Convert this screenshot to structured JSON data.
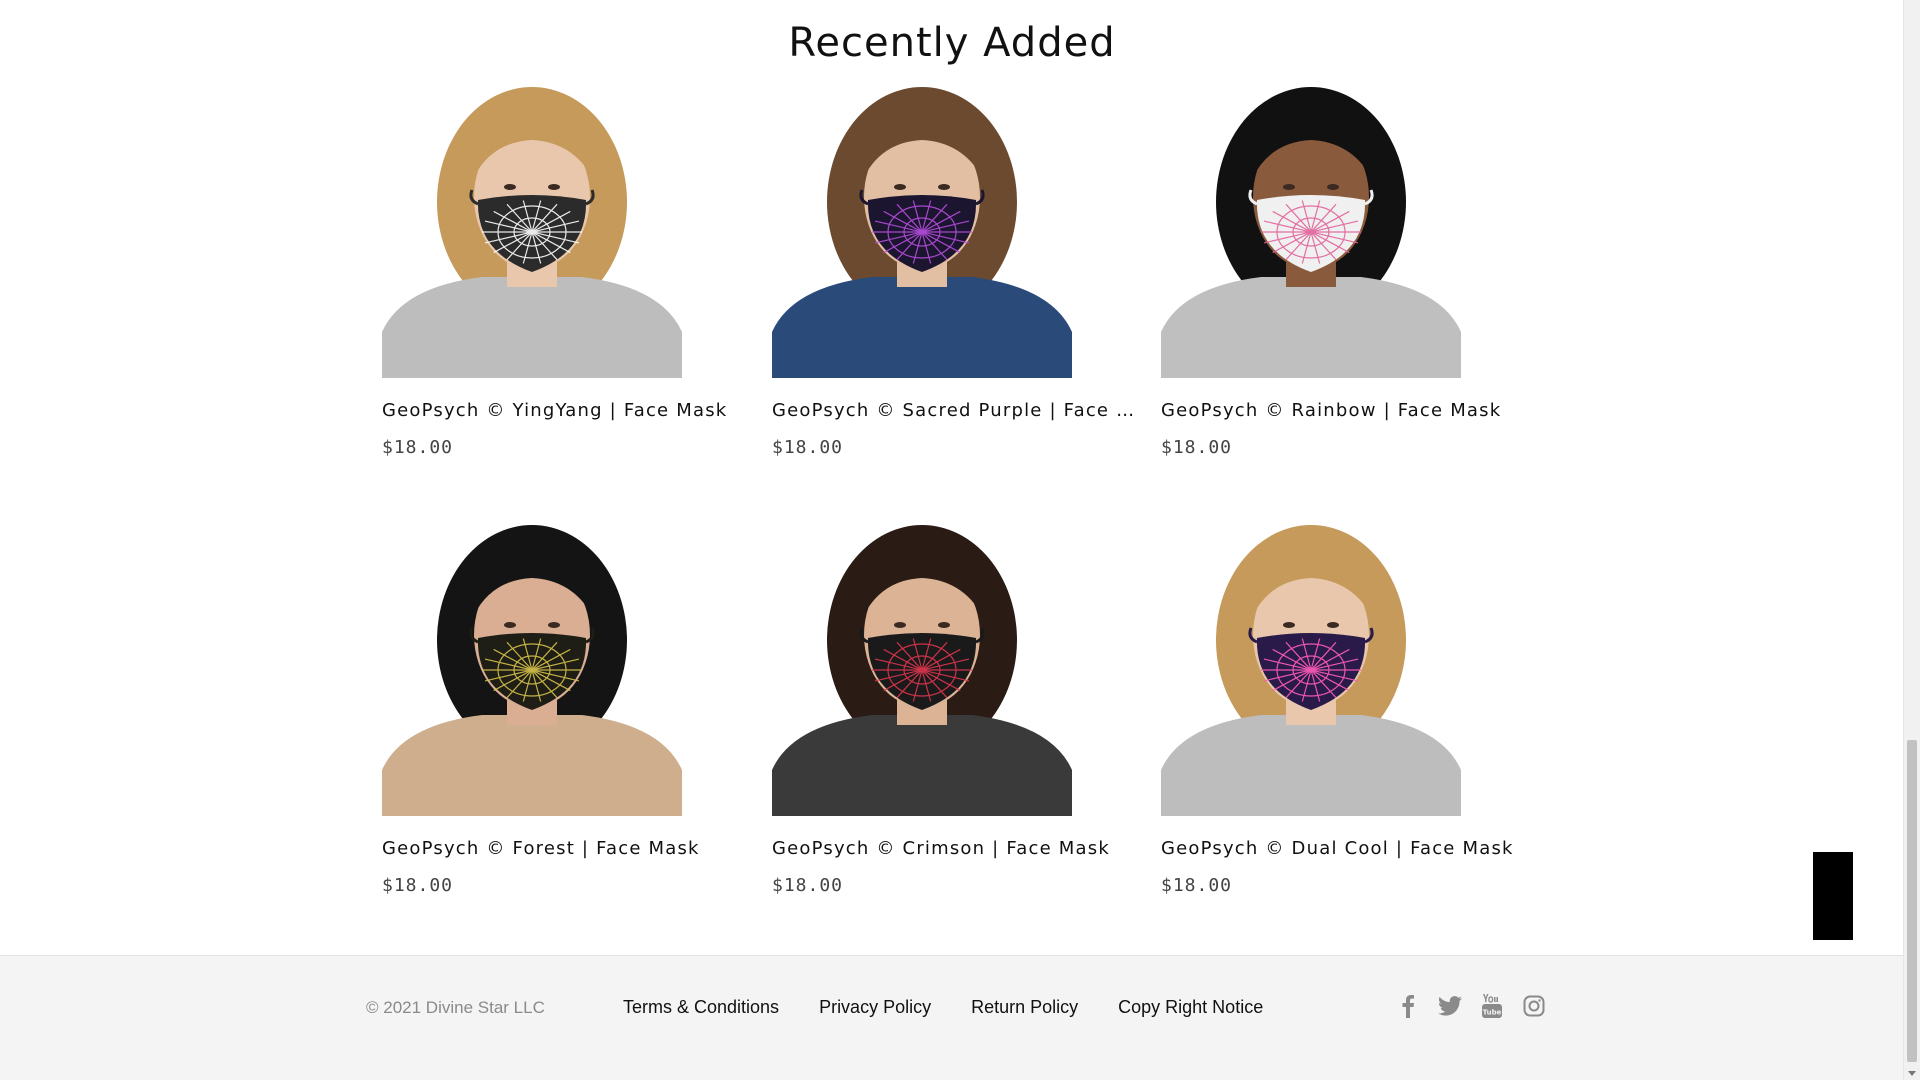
{
  "section": {
    "title": "Recently Added"
  },
  "products": [
    {
      "name": "GeoPsych © YingYang | Face Mask",
      "price": "$18.00",
      "image": "woman-grey-hoodie-black-white-mask",
      "mask_color": "#2b2b2b",
      "mask_lines": "#ffffff",
      "shirt_color": "#bdbdbd",
      "skin": "#e9c7ad",
      "hair": "#c59a5a"
    },
    {
      "name": "GeoPsych © Sacred Purple | Face Mask",
      "price": "$18.00",
      "image": "man-denim-jacket-purple-mask",
      "mask_color": "#1c1530",
      "mask_lines": "#b84de0",
      "shirt_color": "#2a4a7a",
      "skin": "#e2bfa3",
      "hair": "#6b4a30"
    },
    {
      "name": "GeoPsych © Rainbow | Face Mask",
      "price": "$18.00",
      "image": "man-grey-tshirt-rainbow-mask",
      "mask_color": "#f0f0f0",
      "mask_lines": "#e2629a",
      "shirt_color": "#bfbfbf",
      "skin": "#8a5a3c",
      "hair": "#111111"
    },
    {
      "name": "GeoPsych © Forest | Face Mask",
      "price": "$18.00",
      "image": "woman-beige-top-forest-mask",
      "mask_color": "#1e1e16",
      "mask_lines": "#d8c34a",
      "shirt_color": "#cfae8e",
      "skin": "#d9ae93",
      "hair": "#141414"
    },
    {
      "name": "GeoPsych © Crimson | Face Mask",
      "price": "$18.00",
      "image": "woman-dark-tshirt-crimson-mask",
      "mask_color": "#1a1a1a",
      "mask_lines": "#e0354f",
      "shirt_color": "#3a3a3a",
      "skin": "#dcb395",
      "hair": "#2a1c15"
    },
    {
      "name": "GeoPsych © Dual Cool | Face Mask",
      "price": "$18.00",
      "image": "woman-grey-hoodie-dual-cool-mask",
      "mask_color": "#2a1a4a",
      "mask_lines": "#ff5db8",
      "shirt_color": "#bdbdbd",
      "skin": "#e9c7ad",
      "hair": "#c59a5a"
    }
  ],
  "footer": {
    "copyright": "© 2021 Divine Star LLC",
    "links": {
      "terms": "Terms & Conditions",
      "privacy": "Privacy Policy",
      "returns": "Return Policy",
      "copyright_notice": "Copy Right Notice"
    },
    "social": [
      "facebook-icon",
      "twitter-icon",
      "youtube-icon",
      "instagram-icon"
    ]
  }
}
